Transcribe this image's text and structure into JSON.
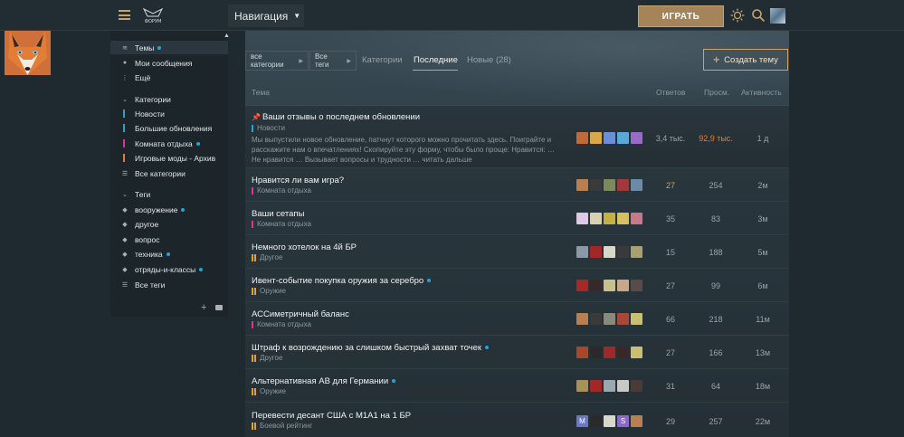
{
  "header": {
    "logo_text": "ФОРУМ",
    "nav_label": "Навигация",
    "play_label": "ИГРАТЬ"
  },
  "sidebar": {
    "top_items": [
      {
        "label": "Темы",
        "icon": "layers-icon",
        "dot": true,
        "active": true
      },
      {
        "label": "Мои сообщения",
        "icon": "user-icon",
        "dot": false
      },
      {
        "label": "Ещё",
        "icon": "more-icon",
        "dot": false
      }
    ],
    "categories_header": "Категории",
    "categories": [
      {
        "label": "Новости",
        "color": "#23a5d6",
        "dot": false
      },
      {
        "label": "Большие обновления",
        "color": "#23a5d6",
        "dot": false
      },
      {
        "label": "Комната отдыха",
        "color": "#e0348f",
        "dot": true
      },
      {
        "label": "Игровые моды - Архив",
        "color": "#f07a2a",
        "dot": false
      },
      {
        "label": "Все категории",
        "icon": "list-icon",
        "dot": false
      }
    ],
    "tags_header": "Теги",
    "tags": [
      {
        "label": "вооружение",
        "dot": true
      },
      {
        "label": "другое",
        "dot": false
      },
      {
        "label": "вопрос",
        "dot": false
      },
      {
        "label": "техника",
        "dot": true
      },
      {
        "label": "отряды-и-классы",
        "dot": true
      },
      {
        "label": "Все теги",
        "icon": "list-icon",
        "dot": false
      }
    ]
  },
  "filters": {
    "categories_label": "все категории",
    "tags_label": "Все теги"
  },
  "tabs": [
    {
      "label": "Категории",
      "active": false
    },
    {
      "label": "Последние",
      "active": true
    },
    {
      "label": "Новые (28)",
      "active": false
    }
  ],
  "create_label": "Создать тему",
  "columns": {
    "topic": "Тема",
    "replies": "Ответов",
    "views": "Просм.",
    "activity": "Активность"
  },
  "topics": [
    {
      "title": "Ваши отзывы о последнем обновлении",
      "category": "Новости",
      "cat_color": "#23a5d6",
      "pinned": true,
      "excerpt": "Мы выпустили новое обновление, патчнут которого можно прочитать здесь. Поиграйте и расскажите нам о впечатлениях! Скопируйте эту форму, чтобы было проще: Нравится: … Не нравится … Вызывает вопросы и трудности … читать дальше",
      "replies": "3,4 тыс.",
      "views": "92,9 тыс.",
      "activity": "1 д",
      "views_hot": "hotter"
    },
    {
      "title": "Нравится ли вам игра?",
      "category": "Комната отдыха",
      "cat_color": "#e0348f",
      "replies": "27",
      "views": "254",
      "activity": "2м",
      "replies_hot": "hot"
    },
    {
      "title": "Ваши сетапы",
      "category": "Комната отдыха",
      "cat_color": "#e0348f",
      "replies": "35",
      "views": "83",
      "activity": "3м"
    },
    {
      "title": "Немного хотелок на 4й БР",
      "category": "Другое",
      "cat_color": "#e4a127",
      "replies": "15",
      "views": "188",
      "activity": "5м"
    },
    {
      "title": "Ивент-событие покупка оружия за серебро",
      "category": "Оружие",
      "cat_color": "#e4a127",
      "dot": true,
      "replies": "27",
      "views": "99",
      "activity": "6м"
    },
    {
      "title": "АССиметричный баланс",
      "category": "Комната отдыха",
      "cat_color": "#e0348f",
      "replies": "66",
      "views": "218",
      "activity": "11м"
    },
    {
      "title": "Штраф к возрождению за слишком быстрый захват точек",
      "category": "Другое",
      "cat_color": "#e4a127",
      "dot": true,
      "replies": "27",
      "views": "166",
      "activity": "13м"
    },
    {
      "title": "Альтернативная АВ для Германии",
      "category": "Оружие",
      "cat_color": "#e4a127",
      "dot": true,
      "replies": "31",
      "views": "64",
      "activity": "18м"
    },
    {
      "title": "Перевести десант США с М1А1 на 1 БР",
      "category": "Боевой рейтинг",
      "cat_color": "#e4a127",
      "replies": "29",
      "views": "257",
      "activity": "22м"
    }
  ]
}
